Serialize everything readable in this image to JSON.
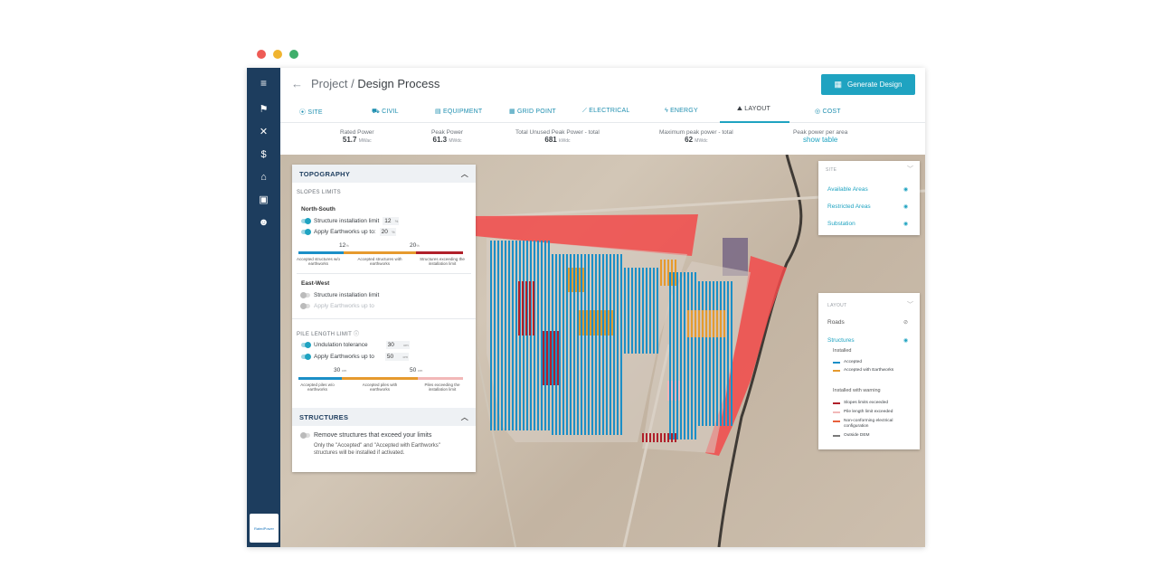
{
  "window": {
    "dots": [
      "#ee5b55",
      "#f0b430",
      "#3fae6b"
    ]
  },
  "sidebar": {
    "icons": [
      "menu-icon",
      "flag-icon",
      "tools-icon",
      "dollar-icon",
      "bank-icon",
      "briefcase-icon",
      "users-icon"
    ],
    "logo_text": "RatedPower"
  },
  "header": {
    "back_glyph": "←",
    "breadcrumb_project": "Project",
    "breadcrumb_sep": " / ",
    "breadcrumb_page": "Design Process",
    "generate_button": "Generate Design"
  },
  "tabs": [
    {
      "label": "SITE",
      "icon": "⦿"
    },
    {
      "label": "CIVIL",
      "icon": "⛟"
    },
    {
      "label": "EQUIPMENT",
      "icon": "▤"
    },
    {
      "label": "GRID POINT",
      "icon": "▦"
    },
    {
      "label": "ELECTRICAL",
      "icon": "⟋"
    },
    {
      "label": "ENERGY",
      "icon": "ϟ"
    },
    {
      "label": "LAYOUT",
      "icon": "⛰"
    },
    {
      "label": "COST",
      "icon": "◎"
    }
  ],
  "active_tab": "LAYOUT",
  "metrics": {
    "rated_power": {
      "label": "Rated Power",
      "value": "51.7",
      "unit": "MWac"
    },
    "peak_power": {
      "label": "Peak Power",
      "value": "61.3",
      "unit": "MWdc"
    },
    "unused_peak": {
      "label": "Total Unused Peak Power - total",
      "value": "681",
      "unit": "kWdc"
    },
    "max_peak": {
      "label": "Maximum peak power - total",
      "value": "62",
      "unit": "MWdc"
    },
    "peak_per_area": {
      "label": "Peak power per area",
      "link": "show table"
    }
  },
  "topography": {
    "title": "TOPOGRAPHY",
    "slopes_limits": "SLOPES LIMITS",
    "north_south": {
      "title": "North-South",
      "structure_limit_label": "Structure installation limit",
      "structure_limit_value": "12",
      "earthworks_label": "Apply Earthworks up to:",
      "earthworks_value": "20",
      "unit": "%",
      "tick1": "12",
      "tick2": "20",
      "bar_labels": [
        "Accepted structures w/o earthworks",
        "Accepted structures with earthworks",
        "Structures exceeding the installation limit"
      ]
    },
    "east_west": {
      "title": "East-West",
      "structure_limit_label": "Structure installation limit",
      "earthworks_label": "Apply Earthworks up to"
    },
    "pile": {
      "title": "PILE LENGTH LIMIT",
      "undulation_label": "Undulation tolerance",
      "undulation_value": "30",
      "earthworks_label": "Apply Earthworks up to",
      "earthworks_value": "50",
      "unit": "cm",
      "tick1": "30",
      "tick2": "50",
      "bar_labels": [
        "Accepted piles w/o earthworks",
        "Accepted piles with earthworks",
        "Piles exceeding the installation limit"
      ]
    }
  },
  "structures": {
    "title": "STRUCTURES",
    "remove_label": "Remove structures that exceed your limits",
    "note_line1": "Only the \"Accepted\" and \"Accepted with Earthworks\"",
    "note_line2": "structures will be installed if activated."
  },
  "site_panel": {
    "title": "SITE",
    "items": [
      "Available Areas",
      "Restricted Areas",
      "Substation"
    ]
  },
  "layout_panel": {
    "title": "LAYOUT",
    "roads": "Roads",
    "structures": "Structures",
    "installed": "Installed",
    "installed_items": [
      {
        "label": "Accepted",
        "color": "#1b8fc7"
      },
      {
        "label": "Accepted with Earthworks",
        "color": "#e69a2e"
      }
    ],
    "warning_title": "Installed with warning",
    "warning_items": [
      {
        "label": "Slopes limits exceeded",
        "color": "#b0202a"
      },
      {
        "label": "Pile length limit exceeded",
        "color": "#f2b8b8"
      },
      {
        "label": "Non-conforming electrical configuration",
        "color": "#e8603c"
      },
      {
        "label": "Outside DEM",
        "color": "#7a7a7a"
      }
    ]
  },
  "colors": {
    "accent": "#1fa3c1",
    "sidebar": "#1d3d5e",
    "accepted": "#1b8fc7",
    "earthworks": "#e69a2e",
    "exceeded": "#b0202a",
    "restricted": "#f24a4a"
  }
}
